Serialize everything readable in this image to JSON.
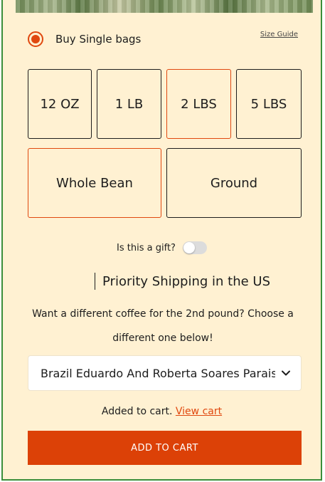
{
  "purchase_type": {
    "label": "Buy Single bags",
    "selected": true
  },
  "size_guide_label": "Size Guide",
  "sizes": [
    {
      "label": "12 OZ",
      "selected": false
    },
    {
      "label": "1 LB",
      "selected": false
    },
    {
      "label": "2 LBS",
      "selected": true
    },
    {
      "label": "5 LBS",
      "selected": false
    }
  ],
  "grind": [
    {
      "label": "Whole Bean",
      "selected": true
    },
    {
      "label": "Ground",
      "selected": false
    }
  ],
  "gift": {
    "label": "Is this a gift?",
    "enabled": false
  },
  "shipping_label": "Priority Shipping in the US",
  "second_pound_message": "Want a different coffee for the 2nd pound? Choose a different one below!",
  "coffee_select": {
    "value": "Brazil Eduardo And Roberta Soares Paraiso"
  },
  "cart_status": {
    "text": "Added to cart.",
    "link": "View cart"
  },
  "add_to_cart_label": "ADD TO CART",
  "colors": {
    "accent": "#e0480f",
    "background": "#fff1d2",
    "button": "#dc4107"
  }
}
